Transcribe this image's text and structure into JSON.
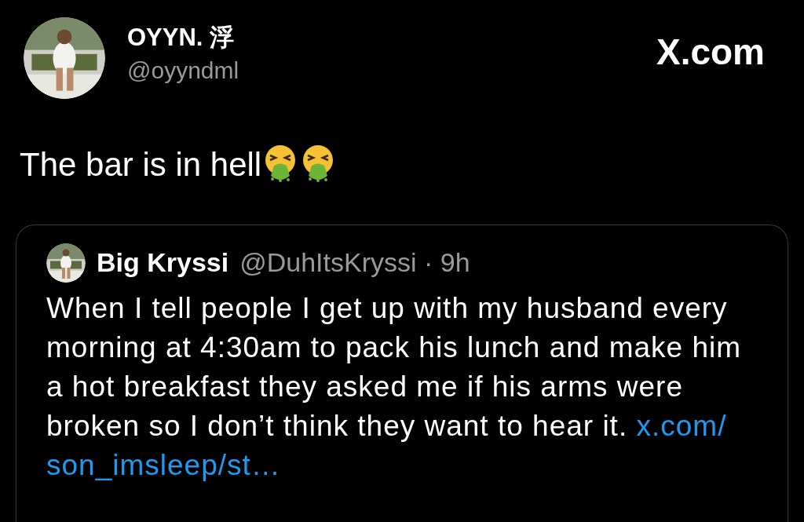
{
  "author": {
    "name": "OYYN. 浮",
    "handle": "@oyyndml"
  },
  "site_label": "X.com",
  "tweet": {
    "text": "The bar is in hell",
    "emojis": [
      {
        "kind": "vomiting"
      },
      {
        "kind": "vomiting"
      }
    ]
  },
  "quote": {
    "name": "Big Kryssi",
    "handle": "@DuhItsKryssi",
    "separator": "·",
    "time": "9h",
    "text": "When I tell people I get up with my husband every morning at 4:30am to pack his lunch and make him a hot breakfast they asked me if his arms were broken so I don’t think they want to hear it.",
    "link_parts": [
      "x.com/",
      "son_imsleep/st…"
    ]
  }
}
